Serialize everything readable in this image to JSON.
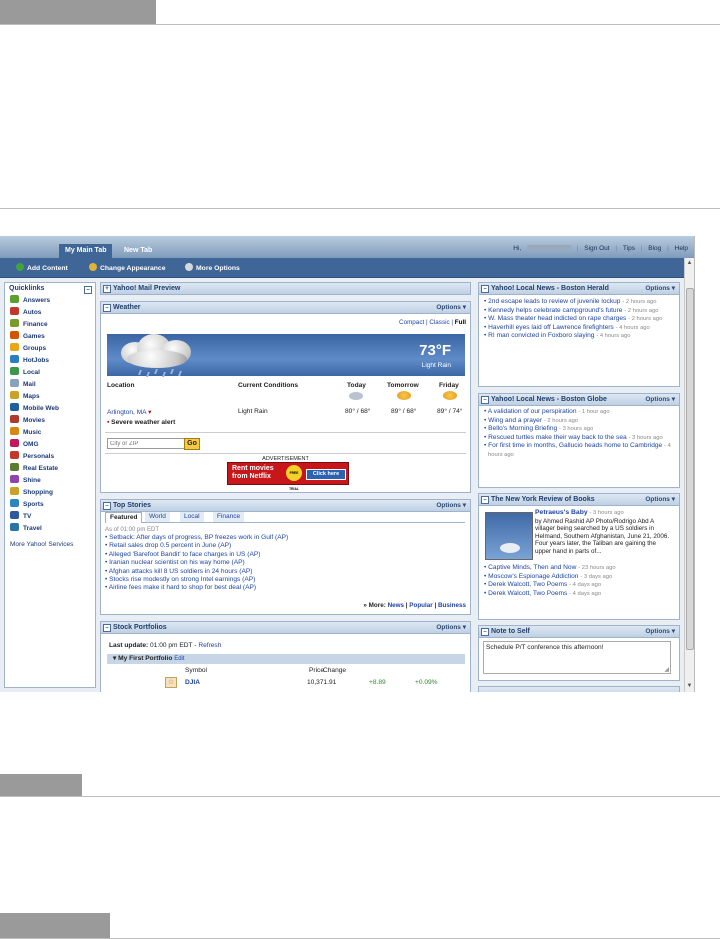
{
  "top_tabs": {
    "main": "My Main Tab",
    "new": "New Tab"
  },
  "top_links": {
    "greeting": "Hi,",
    "sign_out": "Sign Out",
    "tips": "Tips",
    "blog": "Blog",
    "help": "Help"
  },
  "toolbar": {
    "add_content": "Add Content",
    "change_appearance": "Change Appearance",
    "more_options": "More Options"
  },
  "quicklinks": {
    "title": "Quicklinks",
    "items": [
      {
        "label": "Answers",
        "color": "#5aa02c"
      },
      {
        "label": "Autos",
        "color": "#c0392b"
      },
      {
        "label": "Finance",
        "color": "#7a9a2a"
      },
      {
        "label": "Games",
        "color": "#d35400"
      },
      {
        "label": "Groups",
        "color": "#e6a817"
      },
      {
        "label": "HotJobs",
        "color": "#2a7fc1"
      },
      {
        "label": "Local",
        "color": "#3a9a4a"
      },
      {
        "label": "Mail",
        "color": "#8aa0bf"
      },
      {
        "label": "Maps",
        "color": "#c9a227"
      },
      {
        "label": "Mobile Web",
        "color": "#1f5f9f"
      },
      {
        "label": "Movies",
        "color": "#b03a2e"
      },
      {
        "label": "Music",
        "color": "#d68910"
      },
      {
        "label": "OMG",
        "color": "#c2185b"
      },
      {
        "label": "Personals",
        "color": "#c0392b"
      },
      {
        "label": "Real Estate",
        "color": "#5d7b2f"
      },
      {
        "label": "Shine",
        "color": "#8e44ad"
      },
      {
        "label": "Shopping",
        "color": "#c9a227"
      },
      {
        "label": "Sports",
        "color": "#2e86c1"
      },
      {
        "label": "TV",
        "color": "#2c5aa0"
      },
      {
        "label": "Travel",
        "color": "#2874a6"
      }
    ],
    "more": "More Yahoo! Services"
  },
  "mail_preview": {
    "title": "Yahoo! Mail Preview"
  },
  "weather": {
    "title": "Weather",
    "options": "Options",
    "views": [
      "Compact",
      "Classic",
      "Full"
    ],
    "temp": "73°F",
    "condition": "Light Rain",
    "headers": {
      "location": "Location",
      "current": "Current Conditions",
      "today": "Today",
      "tomorrow": "Tomorrow",
      "friday": "Friday"
    },
    "location": "Arlington, MA",
    "current_cond": "Light Rain",
    "today_range": "80° / 68°",
    "tomorrow_range": "89° / 68°",
    "friday_range": "89° / 74°",
    "alert": "Severe weather alert",
    "zip_placeholder": "City or ZIP",
    "go": "Go",
    "ad_label": "ADVERTISEMENT",
    "ad_line1": "Rent movies",
    "ad_line2": "from Netflix",
    "ad_badge": "FREE TRIAL",
    "ad_click": "Click here"
  },
  "top_stories": {
    "title": "Top Stories",
    "options": "Options",
    "tabs": [
      "Featured",
      "World",
      "Local",
      "Finance"
    ],
    "asof": "As of 01:00 pm EDT",
    "items": [
      "Setback: After days of progress, BP freezes work in Gulf (AP)",
      "Retail sales drop 0.5 percent in June (AP)",
      "Alleged 'Barefoot Bandit' to face charges in US (AP)",
      "Iranian nuclear scientist on his way home (AP)",
      "Afghan attacks kill 8 US soldiers in 24 hours (AP)",
      "Stocks rise modestly on strong Intel earnings (AP)",
      "Airline fees make it hard to shop for best deal (AP)"
    ],
    "more_label": "» More:",
    "more_news": "News",
    "more_popular": "Popular",
    "more_business": "Business"
  },
  "stocks": {
    "title": "Stock Portfolios",
    "options": "Options",
    "last_update_label": "Last update:",
    "last_update_time": "01:00 pm EDT -",
    "refresh": "Refresh",
    "portfolio": "My First Portfolio",
    "edit": "Edit",
    "cols": {
      "symbol": "Symbol",
      "price": "Price",
      "change": "Change"
    },
    "rows": [
      {
        "symbol": "DJIA",
        "price": "10,371.91",
        "change": "+8.89",
        "pct": "+0.09%"
      }
    ]
  },
  "herald": {
    "title": "Yahoo! Local News - Boston Herald",
    "options": "Options",
    "items": [
      {
        "text": "2nd escape leads to review of juvenile lockup",
        "time": "- 2 hours ago"
      },
      {
        "text": "Kennedy helps celebrate campground's future",
        "time": "- 2 hours ago"
      },
      {
        "text": "W. Mass theater head indicted on rape charges",
        "time": "- 2 hours ago"
      },
      {
        "text": "Haverhill eyes laid off Lawrence firefighters",
        "time": "- 4 hours ago"
      },
      {
        "text": "RI man convicted in Foxboro slaying",
        "time": "- 4 hours ago"
      }
    ]
  },
  "globe": {
    "title": "Yahoo! Local News - Boston Globe",
    "options": "Options",
    "items": [
      {
        "text": "A validation of our perspiration",
        "time": "- 1 hour ago"
      },
      {
        "text": "Wing and a prayer",
        "time": "- 2 hours ago"
      },
      {
        "text": "Bello's Morning Briefing",
        "time": "- 3 hours ago"
      },
      {
        "text": "Rescued turtles make their way back to the sea",
        "time": "- 3 hours ago"
      },
      {
        "text": "For first time in months, Gallucio heads home to Cambridge",
        "time": "- 4 hours ago"
      }
    ]
  },
  "nyrb": {
    "title": "The New York Review of Books",
    "options": "Options",
    "feature_title": "Petraeus's Baby",
    "feature_time": "- 3 hours ago",
    "feature_text": "by Ahmed Rashid AP Photo/Rodrigo Abd A villager being searched by a US soldiers in Helmand, Southern Afghanistan, June 21, 2006. Four years later, the Taliban are gaining the upper hand in parts of...",
    "items": [
      {
        "text": "Captive Minds, Then and Now",
        "time": "- 23 hours ago"
      },
      {
        "text": "Moscow's Espionage Addiction",
        "time": "- 3 days ago"
      },
      {
        "text": "Derek Walcott, Two Poems",
        "time": "- 4 days ago"
      },
      {
        "text": "Derek Walcott, Two Poems",
        "time": "- 4 days ago"
      }
    ]
  },
  "note": {
    "title": "Note to Self",
    "options": "Options",
    "text": "Schedule P/T conference this afternoon!"
  }
}
